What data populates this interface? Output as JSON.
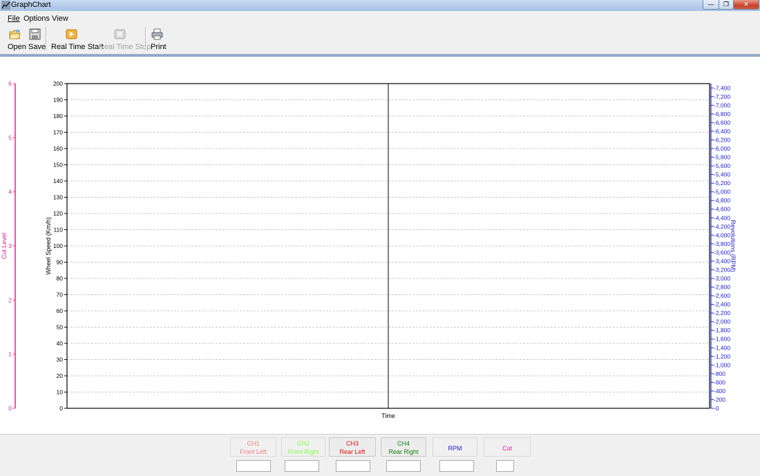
{
  "window": {
    "title": "GraphChart"
  },
  "menu": {
    "items": [
      "File",
      "Options",
      "View"
    ]
  },
  "toolbar": {
    "open_label": "Open",
    "save_label": "Save",
    "rt_start_label": "Real Time Start",
    "rt_stop_label": "Real Time Stop",
    "print_label": "Print"
  },
  "chart_data": {
    "type": "line",
    "xlabel": "Time",
    "left_axis": {
      "label": "Wheel Speed (Km/h)",
      "ylim": [
        0,
        200
      ],
      "ticks": [
        0,
        10,
        20,
        30,
        40,
        50,
        60,
        70,
        80,
        90,
        100,
        110,
        120,
        130,
        140,
        150,
        160,
        170,
        180,
        190,
        200
      ]
    },
    "cut_axis": {
      "label": "Cut Level",
      "ylim": [
        0,
        6
      ],
      "ticks": [
        0,
        1,
        2,
        3,
        4,
        5,
        6
      ],
      "color": "#e0208f"
    },
    "right_axis": {
      "label": "Revolutions (RPM)",
      "ylim": [
        0,
        7500
      ],
      "color": "#2020d0",
      "ticks": [
        "0",
        "200",
        "400",
        "600",
        "800",
        "1,000",
        "1,200",
        "1,400",
        "1,600",
        "1,800",
        "2,000",
        "2,200",
        "2,400",
        "2,600",
        "2,800",
        "3,000",
        "3,200",
        "3,400",
        "3,600",
        "3,800",
        "4,000",
        "4,200",
        "4,400",
        "4,600",
        "4,800",
        "5,000",
        "5,200",
        "5,400",
        "5,600",
        "5,800",
        "6,000",
        "6,200",
        "6,400",
        "6,600",
        "6,800",
        "7,000",
        "7,200",
        "7,400"
      ]
    },
    "grid": true,
    "series": []
  },
  "channels": [
    {
      "id": "CH1",
      "name": "Front Left",
      "color": "#f08080"
    },
    {
      "id": "CH2",
      "name": "Front Right",
      "color": "#80ff40"
    },
    {
      "id": "CH3",
      "name": "Rear Left",
      "color": "#e01010"
    },
    {
      "id": "CH4",
      "name": "Rear Right",
      "color": "#108010"
    },
    {
      "id": "RPM",
      "name": "",
      "color": "#2020d0"
    },
    {
      "id": "Cut",
      "name": "",
      "color": "#e0208f"
    }
  ]
}
